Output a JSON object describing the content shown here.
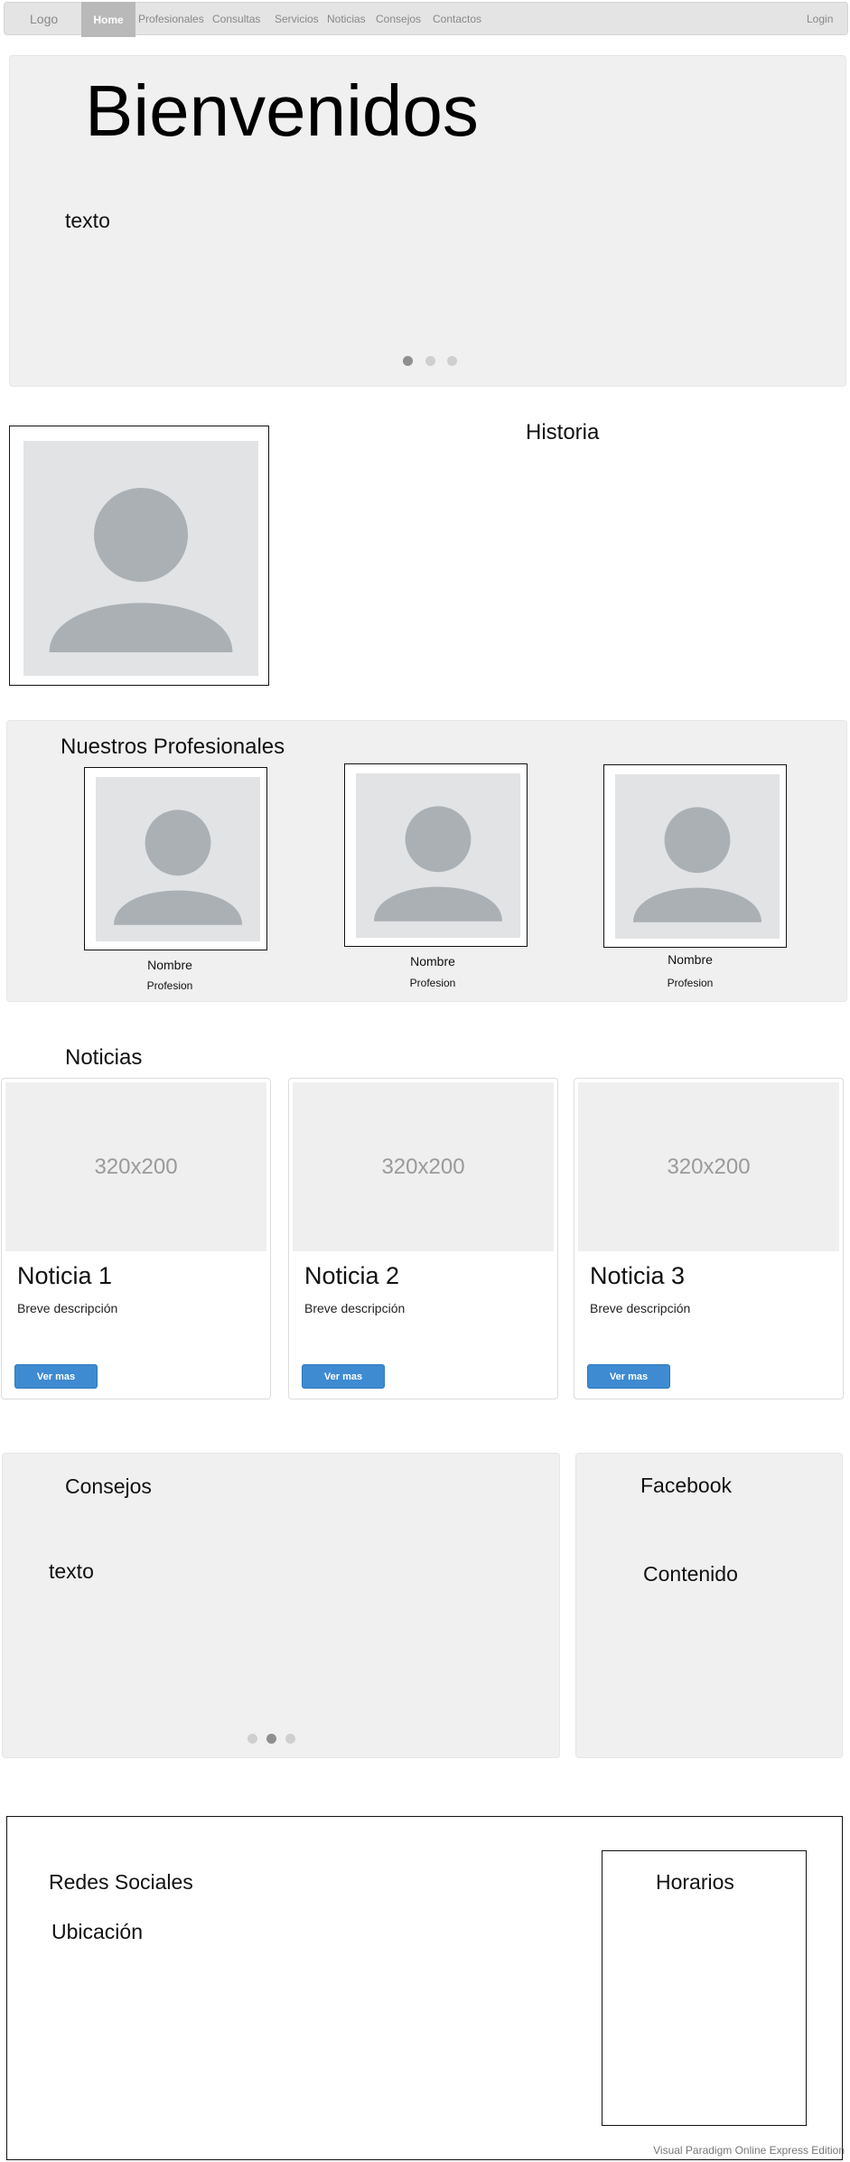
{
  "watermark": {
    "text": "Visual Paradigm Online Express Edition"
  },
  "navbar": {
    "logo": "Logo",
    "items": [
      "Home",
      "Profesionales",
      "Consultas",
      "Servicios",
      "Noticias",
      "Consejos",
      "Contactos"
    ],
    "active_item": "Home",
    "login": "Login"
  },
  "hero": {
    "title": "Bienvenidos",
    "text": "texto",
    "carousel": {
      "total": 3,
      "active": 1
    }
  },
  "history": {
    "title": "Historia"
  },
  "professionals": {
    "title": "Nuestros Profesionales",
    "items": [
      {
        "name": "Nombre",
        "role": "Profesion"
      },
      {
        "name": "Nombre",
        "role": "Profesion"
      },
      {
        "name": "Nombre",
        "role": "Profesion"
      }
    ]
  },
  "news": {
    "title": "Noticias",
    "cards": [
      {
        "image_label": "320x200",
        "title": "Noticia 1",
        "description": "Breve descripción",
        "button": "Ver mas"
      },
      {
        "image_label": "320x200",
        "title": "Noticia 2",
        "description": "Breve descripción",
        "button": "Ver mas"
      },
      {
        "image_label": "320x200",
        "title": "Noticia 3",
        "description": "Breve descripción",
        "button": "Ver mas"
      }
    ]
  },
  "tips": {
    "title": "Consejos",
    "text": "texto",
    "carousel": {
      "total": 3,
      "active": 2
    }
  },
  "facebook": {
    "title": "Facebook",
    "content": "Contenido"
  },
  "footer": {
    "social": "Redes Sociales",
    "location": "Ubicación",
    "hours": "Horarios"
  },
  "colors": {
    "panel": "#f0f0f0",
    "navbar": "#e4e4e4",
    "active_nav": "#b9b9b9",
    "button": "#3e8bd2",
    "avatar_bg": "#e1e3e5",
    "avatar_fg": "#abb0b4"
  },
  "icons": {
    "avatar": "user-placeholder-icon"
  }
}
